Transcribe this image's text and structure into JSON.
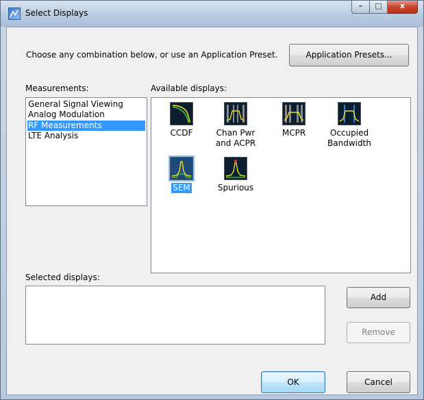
{
  "window": {
    "title": "Select Displays",
    "controls": {
      "minimize": "–",
      "maximize": "□",
      "close": "x"
    }
  },
  "intro": {
    "text": "Choose any combination below, or use an Application Preset.",
    "presets_button": "Application Presets..."
  },
  "measurements": {
    "label": "Measurements:",
    "items": [
      {
        "label": "General Signal Viewing",
        "selected": false
      },
      {
        "label": "Analog Modulation",
        "selected": false
      },
      {
        "label": "RF Measurements",
        "selected": true
      },
      {
        "label": "LTE Analysis",
        "selected": false
      }
    ]
  },
  "available": {
    "label": "Available displays:",
    "items": [
      {
        "label": "CCDF",
        "icon": "ccdf-icon",
        "selected": false
      },
      {
        "label": "Chan Pwr and ACPR",
        "icon": "chan-pwr-acpr-icon",
        "selected": false
      },
      {
        "label": "MCPR",
        "icon": "mcpr-icon",
        "selected": false
      },
      {
        "label": "Occupied Bandwidth",
        "icon": "occupied-bandwidth-icon",
        "selected": false
      },
      {
        "label": "SEM",
        "icon": "sem-icon",
        "selected": true
      },
      {
        "label": "Spurious",
        "icon": "spurious-icon",
        "selected": false
      }
    ]
  },
  "selected_displays": {
    "label": "Selected displays:",
    "add_button": "Add",
    "remove_button": "Remove"
  },
  "footer": {
    "ok_button": "OK",
    "cancel_button": "Cancel"
  },
  "colors": {
    "selection": "#3399ff",
    "thumb_bg": "#0b1f2e",
    "trace_yellow": "#f0e020",
    "trace_green": "#40d040"
  }
}
